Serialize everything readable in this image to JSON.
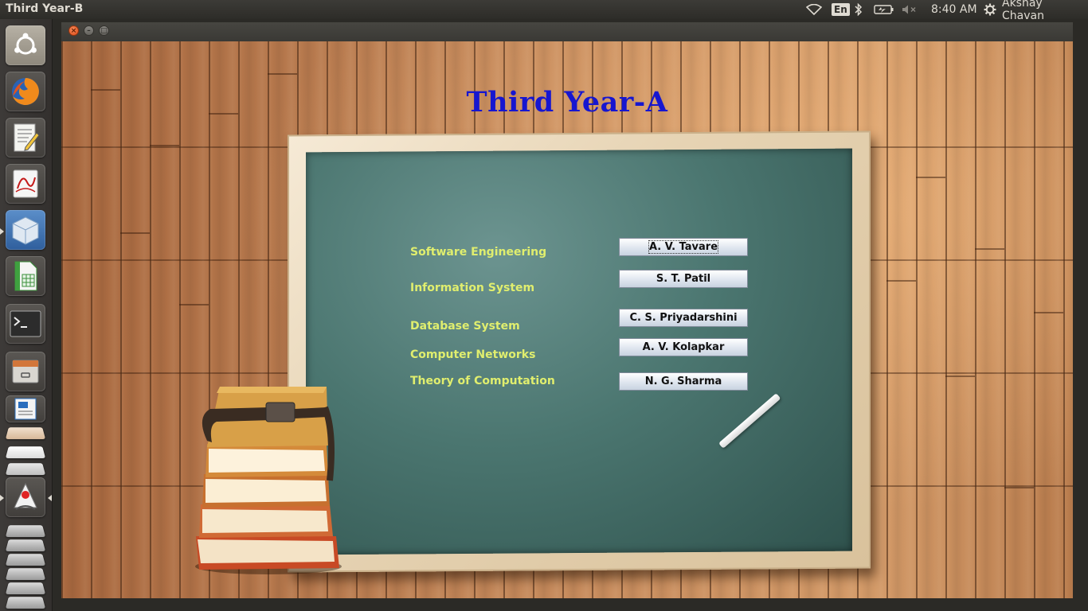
{
  "top_panel": {
    "window_title": "Third Year-B",
    "language": "En",
    "clock": "8:40 AM",
    "user": "Akshay Chavan"
  },
  "launcher": {
    "items": [
      {
        "name": "ubuntu-home-icon"
      },
      {
        "name": "firefox-icon"
      },
      {
        "name": "text-editor-icon"
      },
      {
        "name": "document-viewer-icon"
      },
      {
        "name": "virtualbox-icon"
      },
      {
        "name": "spreadsheet-icon"
      },
      {
        "name": "terminal-icon"
      },
      {
        "name": "file-manager-icon"
      },
      {
        "name": "writer-icon"
      },
      {
        "name": "java-app-icon"
      }
    ]
  },
  "app": {
    "title": "Third Year-A",
    "subjects": [
      {
        "subject": "Software Engineering",
        "teacher": "A. V. Tavare"
      },
      {
        "subject": "Information System",
        "teacher": "S. T. Patil"
      },
      {
        "subject": "Database System",
        "teacher": "C. S. Priyadarshini"
      },
      {
        "subject": "Computer Networks",
        "teacher": "A. V. Kolapkar"
      },
      {
        "subject": "Theory of Computation",
        "teacher": "N. G. Sharma"
      }
    ]
  },
  "colors": {
    "title": "#1616d0",
    "subject_text": "#e0ee6e",
    "chalkboard": "#4b7670",
    "close_button": "#df4a16"
  }
}
